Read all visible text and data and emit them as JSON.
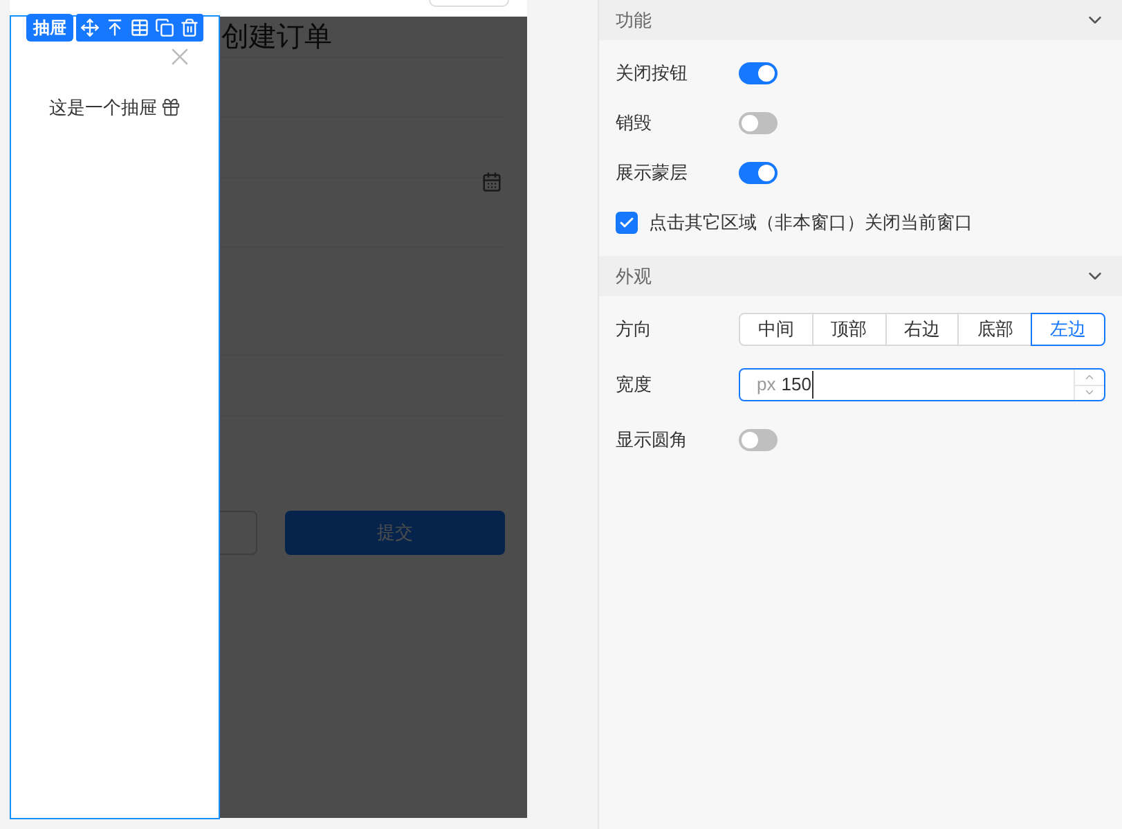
{
  "canvas": {
    "form": {
      "title": "创建订单",
      "submit_button": "提交"
    },
    "drawer": {
      "tag": "抽屉",
      "text": "这是一个抽屉",
      "close_button": true
    }
  },
  "panel": {
    "sections": [
      {
        "title": "功能",
        "expanded": true,
        "rows": [
          {
            "kind": "switch",
            "label": "关闭按钮",
            "on": true
          },
          {
            "kind": "switch",
            "label": "销毁",
            "on": false
          },
          {
            "kind": "switch",
            "label": "展示蒙层",
            "on": true
          },
          {
            "kind": "checkbox",
            "label": "点击其它区域（非本窗口）关闭当前窗口",
            "checked": true
          }
        ]
      },
      {
        "title": "外观",
        "expanded": true,
        "rows": [
          {
            "kind": "segmented",
            "label": "方向",
            "options": [
              {
                "label": "中间",
                "selected": false
              },
              {
                "label": "顶部",
                "selected": false
              },
              {
                "label": "右边",
                "selected": false
              },
              {
                "label": "底部",
                "selected": false
              },
              {
                "label": "左边",
                "selected": true
              }
            ]
          },
          {
            "kind": "number",
            "label": "宽度",
            "prefix": "px",
            "value": "150"
          },
          {
            "kind": "switch",
            "label": "显示圆角",
            "on": false
          }
        ]
      }
    ]
  }
}
